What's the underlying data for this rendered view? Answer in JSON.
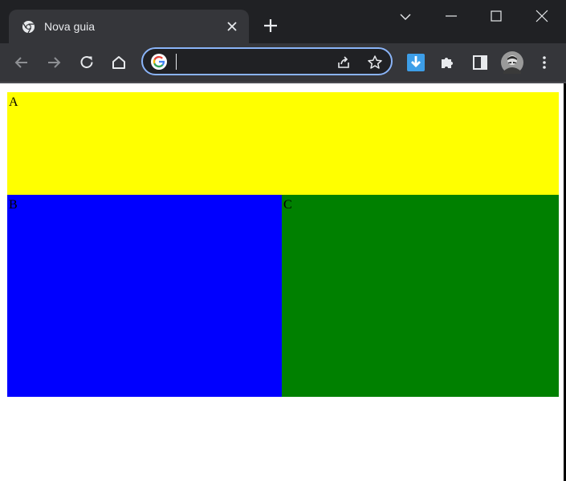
{
  "window": {
    "tab": {
      "title": "Nova guia",
      "favicon": "chrome-icon",
      "close_icon": "close-icon"
    },
    "new_tab_icon": "plus-icon",
    "controls": [
      "tab-search-icon",
      "minimize-icon",
      "maximize-icon",
      "window-close-icon"
    ]
  },
  "toolbar": {
    "buttons": [
      "back-icon",
      "forward-icon",
      "reload-icon",
      "home-icon"
    ],
    "omnibox": {
      "value": "",
      "engine_icon": "google-icon",
      "actions": [
        "share-icon",
        "bookmark-star-icon"
      ]
    },
    "extensions": [
      "download-extension-icon",
      "puzzle-icon",
      "side-panel-icon",
      "avatar",
      "kebab-menu-icon"
    ]
  },
  "page": {
    "boxes": [
      {
        "label": "A",
        "color": "#ffff00"
      },
      {
        "label": "B",
        "color": "#0000ff"
      },
      {
        "label": "C",
        "color": "#008000"
      }
    ]
  },
  "colors": {
    "tabstrip": "#202124",
    "toolbar": "#35363a",
    "omnibox_focus": "#8ab4f8",
    "accent_download": "#3d9ee8"
  }
}
